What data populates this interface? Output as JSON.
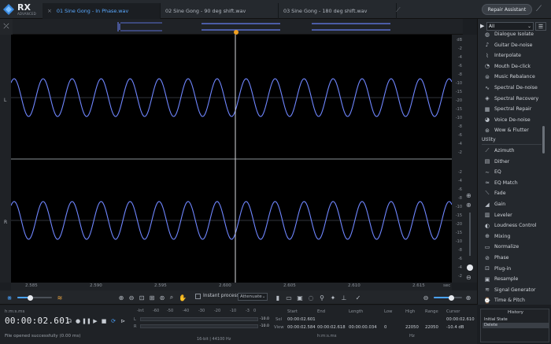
{
  "app": {
    "name": "RX",
    "edition": "ADVANCED"
  },
  "tabs": [
    {
      "label": "01 Sine Gong - In Phase.wav",
      "active": true
    },
    {
      "label": "02 Sine Gong - 90 deg shift.wav",
      "active": false
    },
    {
      "label": "03 Sine Gong - 180 deg shift.wav",
      "active": false
    }
  ],
  "repair_assistant_label": "Repair Assistant",
  "channels": {
    "left": "L",
    "right": "R"
  },
  "db_ticks": [
    "dB",
    "-2",
    "-4",
    "-6",
    "-8",
    "-10",
    "-15",
    "-20",
    "-15",
    "-10",
    "-8",
    "-6",
    "-4",
    "-2"
  ],
  "timeline": {
    "labels": [
      "2.585",
      "2.590",
      "2.595",
      "2.600",
      "2.605",
      "2.610",
      "2.615"
    ],
    "unit": "sec"
  },
  "toolbar": {
    "instant_process_label": "Instant process",
    "attenuate_value": "Attenuate"
  },
  "transport": {
    "format_label": "h:m:s.ms",
    "time": "00:00:02.601",
    "status": "File opened successfully (0.00 ms)"
  },
  "meter": {
    "scale": [
      "-Inf.",
      "-60",
      "-50",
      "-40",
      "-30",
      "-20",
      "-10",
      "-3",
      "0"
    ],
    "left_channel": "L",
    "right_channel": "R",
    "left_peak": "-10.0",
    "right_peak": "-10.0",
    "format": "16-bit | 44100 Hz"
  },
  "selection": {
    "headers": [
      "Start",
      "End",
      "Length",
      "Low",
      "High",
      "Range",
      "Cursor"
    ],
    "sel_label": "Sel",
    "view_label": "View",
    "sel": {
      "start": "00:00:02.601",
      "end": "",
      "length": ""
    },
    "view": {
      "start": "00:00:02.584",
      "end": "00:00:02.618",
      "length": "00:00:00.034"
    },
    "low": "0",
    "high": "22050",
    "range": "22050",
    "cursor_time": "00:00:02.610",
    "cursor_db": "-10.4 dB",
    "time_format": "h:m:s.ms",
    "freq_unit": "Hz"
  },
  "modules": {
    "filter": "All",
    "items": [
      {
        "label": "Dialogue Isolate",
        "icon": "dialogue-isolate-icon"
      },
      {
        "label": "Guitar De-noise",
        "icon": "guitar-icon"
      },
      {
        "label": "Interpolate",
        "icon": "interpolate-icon"
      },
      {
        "label": "Mouth De-click",
        "icon": "mouth-icon"
      },
      {
        "label": "Music Rebalance",
        "icon": "music-rebalance-icon"
      },
      {
        "label": "Spectral De-noise",
        "icon": "spectral-denoise-icon"
      },
      {
        "label": "Spectral Recovery",
        "icon": "spectral-recovery-icon"
      },
      {
        "label": "Spectral Repair",
        "icon": "spectral-repair-icon"
      },
      {
        "label": "Voice De-noise",
        "icon": "voice-icon"
      },
      {
        "label": "Wow & Flutter",
        "icon": "wow-flutter-icon"
      }
    ],
    "utility_label": "Utility",
    "utility_items": [
      {
        "label": "Azimuth",
        "icon": "azimuth-icon"
      },
      {
        "label": "Dither",
        "icon": "dither-icon"
      },
      {
        "label": "EQ",
        "icon": "eq-icon"
      },
      {
        "label": "EQ Match",
        "icon": "eq-match-icon"
      },
      {
        "label": "Fade",
        "icon": "fade-icon"
      },
      {
        "label": "Gain",
        "icon": "gain-icon"
      },
      {
        "label": "Leveler",
        "icon": "leveler-icon"
      },
      {
        "label": "Loudness Control",
        "icon": "loudness-icon"
      },
      {
        "label": "Mixing",
        "icon": "mixing-icon"
      },
      {
        "label": "Normalize",
        "icon": "normalize-icon"
      },
      {
        "label": "Phase",
        "icon": "phase-icon"
      },
      {
        "label": "Plug-in",
        "icon": "plugin-icon"
      },
      {
        "label": "Resample",
        "icon": "resample-icon"
      },
      {
        "label": "Signal Generator",
        "icon": "signal-generator-icon"
      },
      {
        "label": "Time & Pitch",
        "icon": "time-pitch-icon"
      }
    ]
  },
  "history": {
    "title": "History",
    "items": [
      "Initial State",
      "Delete"
    ]
  },
  "colors": {
    "accent": "#4aa3ff",
    "waveform": "#6f86ff",
    "playhead": "#f0a020"
  }
}
